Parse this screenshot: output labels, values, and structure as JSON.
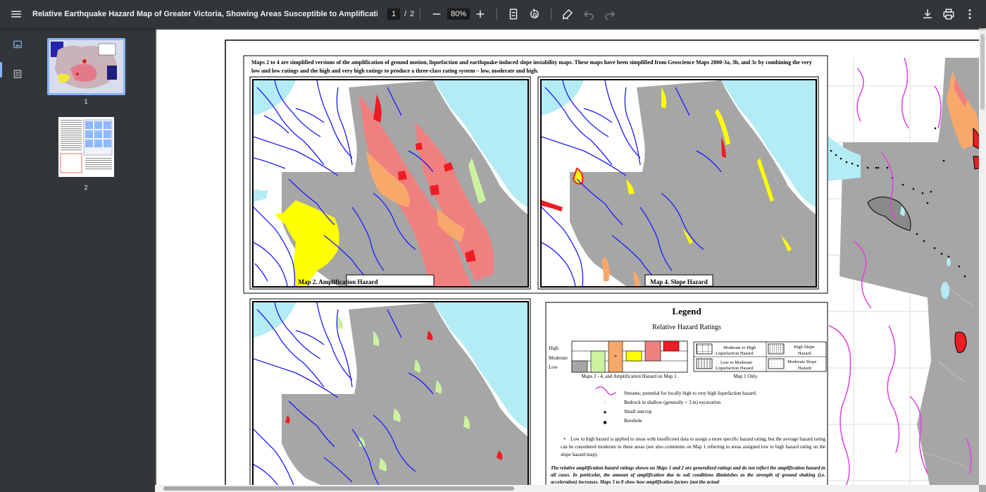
{
  "toolbar": {
    "title": "Relative Earthquake Hazard Map of Greater Victoria, Showing Areas Susceptible to Amplification of Grou...",
    "current_page": "1",
    "page_separator": "/",
    "total_pages": "2",
    "zoom": "80%"
  },
  "sidebar": {
    "thumbnails": [
      {
        "label": "1",
        "selected": true
      },
      {
        "label": "2",
        "selected": false
      }
    ]
  },
  "document": {
    "intro": "Maps 2 to 4 are simplified versions of the amplification of ground motion, liquefaction and earthquake-induced slope instability maps. These maps have been simplified from Geoscience Maps 2000-3a, 3b, and 3c by combining the very low and low ratings and the high and very high ratings to produce a three-class rating system – low, moderate and high.",
    "map2_label": "Map 2. Amplification Hazard",
    "map4_label": "Map 4. Slope Hazard",
    "legend": {
      "title": "Legend",
      "subtitle": "Relative Hazard Ratings",
      "levels": [
        "High",
        "Moderate",
        "Low"
      ],
      "star": "*",
      "caption_left": "Maps 2 - 4, and Amplification Hazard on Map 1.",
      "caption_right": "Map 1 Only.",
      "pattern_items": [
        "Moderate to High Liquefaction Hazard",
        "Low  to Moderate Liquefaction Hazard",
        "High Slope Hazard",
        "Moderate Slope Hazard"
      ],
      "symbols": [
        "Streams; potential for locally high to very high liquefaction hazard.",
        "Bedrock in shallow (generally < 3 m) excavation",
        "Small outcrop",
        "Borehole"
      ],
      "symbol_marks": [
        ":",
        "★",
        "●"
      ],
      "note_star": "*",
      "note": "Low to high hazard is applied to areas with insufficient data to assign a more specific hazard rating, but the average hazard rating can be considered moderate in these areas (see also comments on Map 1 referring to areas assigned low to high hazard rating on the slope hazard map).",
      "italic_note": "The relative amplification hazard ratings shown on Maps 1 and 2 are generalized ratings and do not reflect the amplification hazard in all cases. In particular, the amount of amplification due to soil conditions diminishes as the strength of ground shaking (i.e. acceleration) increases. Maps 5 to 8 show how amplification factors (not the actual"
    }
  },
  "colors": {
    "toolbar": "#323639",
    "viewer_bg": "#525659",
    "accent": "#8ab4f8",
    "water": "#b3ecf4",
    "land_gray": "#a6a6a6",
    "stream_blue": "#1a1aff",
    "hazard_high": "#ee1c24",
    "hazard_pink": "#f08080",
    "hazard_orange": "#f7a86a",
    "hazard_yellow": "#ffff00",
    "hazard_lightgreen": "#ccf2a0",
    "stream_magenta": "#e040e0"
  },
  "icons": {
    "menu": "menu-icon",
    "zoom_out": "minus-icon",
    "zoom_in": "plus-icon",
    "fit_page": "fit-page-icon",
    "rotate": "rotate-icon",
    "annotate": "draw-icon",
    "undo": "undo-icon",
    "redo": "redo-icon",
    "download": "download-icon",
    "print": "print-icon",
    "more": "more-vertical-icon"
  }
}
